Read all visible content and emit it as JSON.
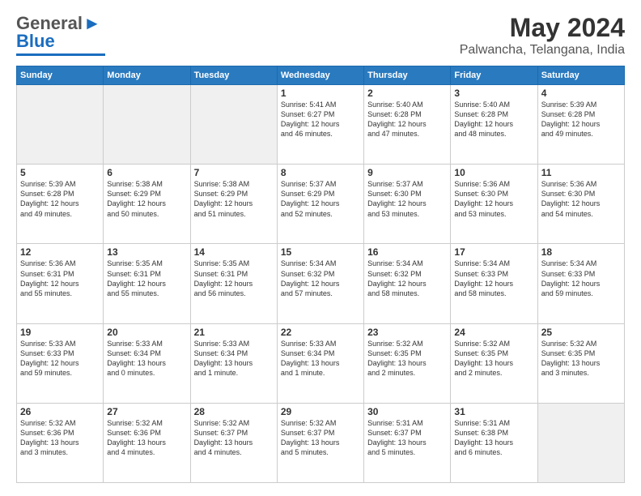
{
  "header": {
    "logo_line1": "General",
    "logo_line2": "Blue",
    "month_title": "May 2024",
    "location": "Palwancha, Telangana, India"
  },
  "weekdays": [
    "Sunday",
    "Monday",
    "Tuesday",
    "Wednesday",
    "Thursday",
    "Friday",
    "Saturday"
  ],
  "weeks": [
    [
      {
        "day": "",
        "info": "",
        "empty": true
      },
      {
        "day": "",
        "info": "",
        "empty": true
      },
      {
        "day": "",
        "info": "",
        "empty": true
      },
      {
        "day": "1",
        "info": "Sunrise: 5:41 AM\nSunset: 6:27 PM\nDaylight: 12 hours\nand 46 minutes."
      },
      {
        "day": "2",
        "info": "Sunrise: 5:40 AM\nSunset: 6:28 PM\nDaylight: 12 hours\nand 47 minutes."
      },
      {
        "day": "3",
        "info": "Sunrise: 5:40 AM\nSunset: 6:28 PM\nDaylight: 12 hours\nand 48 minutes."
      },
      {
        "day": "4",
        "info": "Sunrise: 5:39 AM\nSunset: 6:28 PM\nDaylight: 12 hours\nand 49 minutes."
      }
    ],
    [
      {
        "day": "5",
        "info": "Sunrise: 5:39 AM\nSunset: 6:28 PM\nDaylight: 12 hours\nand 49 minutes."
      },
      {
        "day": "6",
        "info": "Sunrise: 5:38 AM\nSunset: 6:29 PM\nDaylight: 12 hours\nand 50 minutes."
      },
      {
        "day": "7",
        "info": "Sunrise: 5:38 AM\nSunset: 6:29 PM\nDaylight: 12 hours\nand 51 minutes."
      },
      {
        "day": "8",
        "info": "Sunrise: 5:37 AM\nSunset: 6:29 PM\nDaylight: 12 hours\nand 52 minutes."
      },
      {
        "day": "9",
        "info": "Sunrise: 5:37 AM\nSunset: 6:30 PM\nDaylight: 12 hours\nand 53 minutes."
      },
      {
        "day": "10",
        "info": "Sunrise: 5:36 AM\nSunset: 6:30 PM\nDaylight: 12 hours\nand 53 minutes."
      },
      {
        "day": "11",
        "info": "Sunrise: 5:36 AM\nSunset: 6:30 PM\nDaylight: 12 hours\nand 54 minutes."
      }
    ],
    [
      {
        "day": "12",
        "info": "Sunrise: 5:36 AM\nSunset: 6:31 PM\nDaylight: 12 hours\nand 55 minutes."
      },
      {
        "day": "13",
        "info": "Sunrise: 5:35 AM\nSunset: 6:31 PM\nDaylight: 12 hours\nand 55 minutes."
      },
      {
        "day": "14",
        "info": "Sunrise: 5:35 AM\nSunset: 6:31 PM\nDaylight: 12 hours\nand 56 minutes."
      },
      {
        "day": "15",
        "info": "Sunrise: 5:34 AM\nSunset: 6:32 PM\nDaylight: 12 hours\nand 57 minutes."
      },
      {
        "day": "16",
        "info": "Sunrise: 5:34 AM\nSunset: 6:32 PM\nDaylight: 12 hours\nand 58 minutes."
      },
      {
        "day": "17",
        "info": "Sunrise: 5:34 AM\nSunset: 6:33 PM\nDaylight: 12 hours\nand 58 minutes."
      },
      {
        "day": "18",
        "info": "Sunrise: 5:34 AM\nSunset: 6:33 PM\nDaylight: 12 hours\nand 59 minutes."
      }
    ],
    [
      {
        "day": "19",
        "info": "Sunrise: 5:33 AM\nSunset: 6:33 PM\nDaylight: 12 hours\nand 59 minutes."
      },
      {
        "day": "20",
        "info": "Sunrise: 5:33 AM\nSunset: 6:34 PM\nDaylight: 13 hours\nand 0 minutes."
      },
      {
        "day": "21",
        "info": "Sunrise: 5:33 AM\nSunset: 6:34 PM\nDaylight: 13 hours\nand 1 minute."
      },
      {
        "day": "22",
        "info": "Sunrise: 5:33 AM\nSunset: 6:34 PM\nDaylight: 13 hours\nand 1 minute."
      },
      {
        "day": "23",
        "info": "Sunrise: 5:32 AM\nSunset: 6:35 PM\nDaylight: 13 hours\nand 2 minutes."
      },
      {
        "day": "24",
        "info": "Sunrise: 5:32 AM\nSunset: 6:35 PM\nDaylight: 13 hours\nand 2 minutes."
      },
      {
        "day": "25",
        "info": "Sunrise: 5:32 AM\nSunset: 6:35 PM\nDaylight: 13 hours\nand 3 minutes."
      }
    ],
    [
      {
        "day": "26",
        "info": "Sunrise: 5:32 AM\nSunset: 6:36 PM\nDaylight: 13 hours\nand 3 minutes."
      },
      {
        "day": "27",
        "info": "Sunrise: 5:32 AM\nSunset: 6:36 PM\nDaylight: 13 hours\nand 4 minutes."
      },
      {
        "day": "28",
        "info": "Sunrise: 5:32 AM\nSunset: 6:37 PM\nDaylight: 13 hours\nand 4 minutes."
      },
      {
        "day": "29",
        "info": "Sunrise: 5:32 AM\nSunset: 6:37 PM\nDaylight: 13 hours\nand 5 minutes."
      },
      {
        "day": "30",
        "info": "Sunrise: 5:31 AM\nSunset: 6:37 PM\nDaylight: 13 hours\nand 5 minutes."
      },
      {
        "day": "31",
        "info": "Sunrise: 5:31 AM\nSunset: 6:38 PM\nDaylight: 13 hours\nand 6 minutes."
      },
      {
        "day": "",
        "info": "",
        "empty": true
      }
    ]
  ]
}
